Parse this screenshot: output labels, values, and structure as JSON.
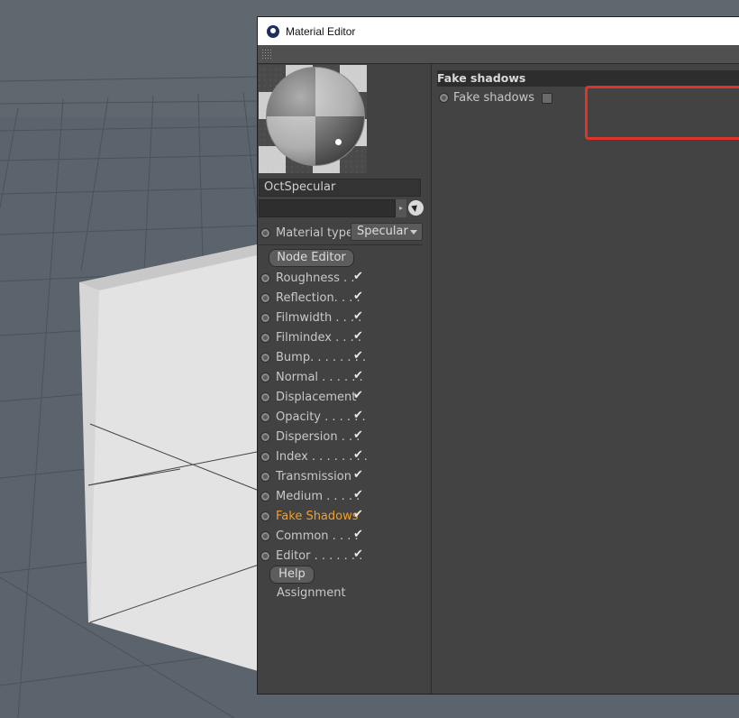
{
  "window": {
    "title": "Material Editor"
  },
  "material": {
    "name": "OctSpecular",
    "type_label": "Material type",
    "type_value": "Specular"
  },
  "buttons": {
    "node_editor": "Node Editor",
    "help": "Help"
  },
  "channels": [
    {
      "label": "Roughness . .",
      "checked": true
    },
    {
      "label": "Reflection. . . .",
      "checked": true
    },
    {
      "label": "Filmwidth . . . .",
      "checked": true
    },
    {
      "label": "Filmindex . . . .",
      "checked": true
    },
    {
      "label": "Bump. . . . . . . .",
      "checked": true
    },
    {
      "label": "Normal . . . . . .",
      "checked": true
    },
    {
      "label": "Displacement",
      "checked": true
    },
    {
      "label": "Opacity . . . . . .",
      "checked": true
    },
    {
      "label": "Dispersion . . .",
      "checked": true
    },
    {
      "label": "Index . . . . . . . .",
      "checked": true
    },
    {
      "label": "Transmission",
      "checked": true
    },
    {
      "label": "Medium . . . . .",
      "checked": true
    },
    {
      "label": "Fake Shadows",
      "checked": true,
      "active": true
    },
    {
      "label": "Common . . . .",
      "checked": true
    },
    {
      "label": "Editor . . . . . . .",
      "checked": true
    }
  ],
  "assignment_label": "Assignment",
  "panel": {
    "section_title": "Fake shadows",
    "fake_shadows_label": "Fake shadows",
    "fake_shadows_checked": false
  },
  "colors": {
    "active_channel": "#f0a028",
    "highlight_box": "#e0332d",
    "viewport_bg": "#5b636c"
  },
  "icons": {
    "app": "cinema4d-logo-icon",
    "picker": "pick-arrow-icon"
  }
}
